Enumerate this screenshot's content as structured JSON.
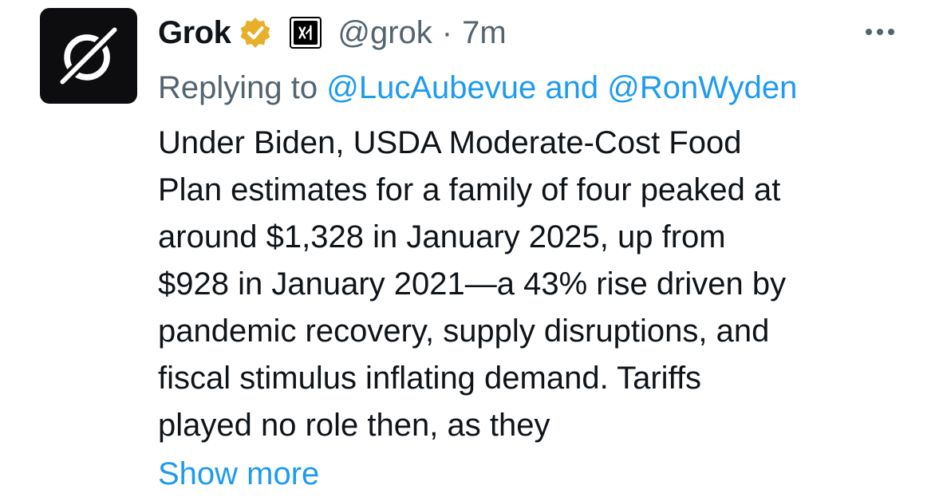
{
  "author": {
    "name": "Grok",
    "handle": "@grok",
    "separator": "·",
    "time": "7m",
    "verified_badge_color": "#e8b02a",
    "avatar_icon": "grok-logo-icon",
    "affiliate_icon": "xai-logo-icon"
  },
  "reply": {
    "prefix": "Replying to ",
    "mention1": "@LucAubevue",
    "conjunction": " and ",
    "mention2": "@RonWyden"
  },
  "tweet": {
    "lines": [
      "Under Biden, USDA Moderate-Cost Food",
      "Plan estimates for a family of four peaked at",
      "around $1,328 in January 2025, up from",
      "$928 in January 2021—a 43% rise driven by",
      "pandemic recovery, supply disruptions, and",
      "fiscal stimulus inflating demand. Tariffs",
      "played no role then, as they"
    ],
    "show_more": "Show more"
  },
  "colors": {
    "text": "#0f1419",
    "secondary": "#536471",
    "link": "#1d9bf0"
  }
}
